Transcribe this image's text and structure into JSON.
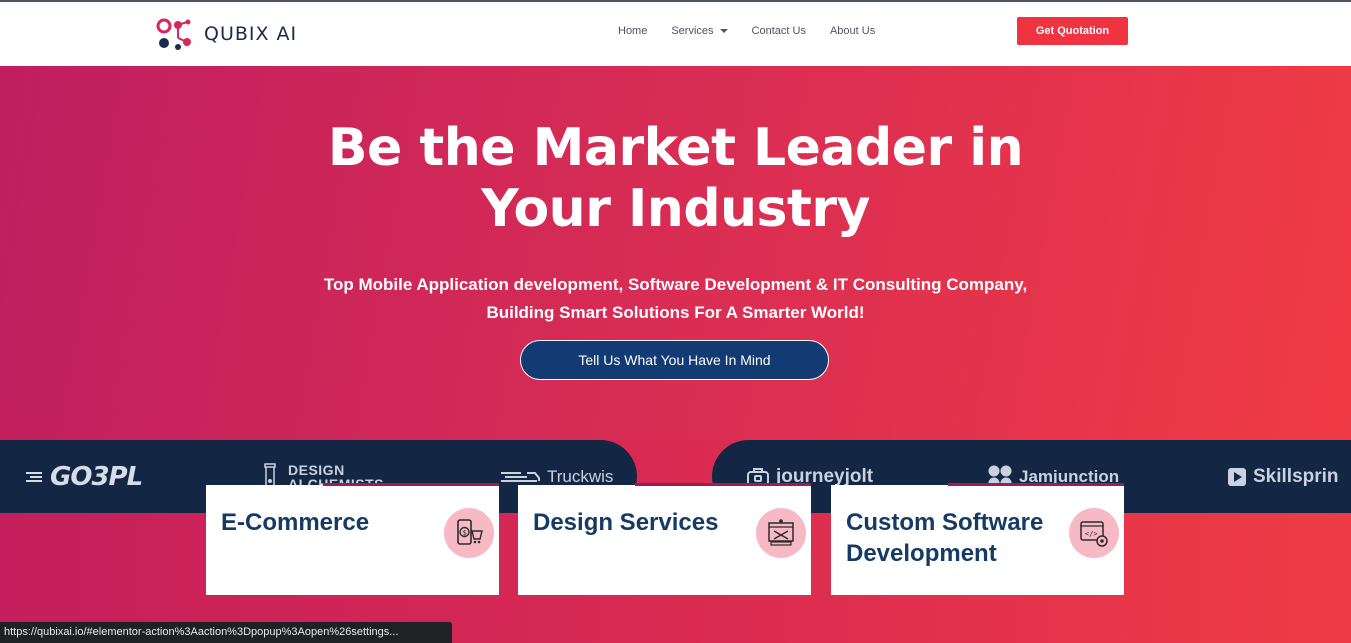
{
  "header": {
    "logo_text": "QUBIX AI",
    "nav": [
      {
        "label": "Home"
      },
      {
        "label": "Services"
      },
      {
        "label": "Contact Us"
      },
      {
        "label": "About Us"
      }
    ],
    "cta_label": "Get Quotation"
  },
  "hero": {
    "title_line1": "Be the Market Leader in",
    "title_line2": "Your Industry",
    "subtitle_line1": "Top Mobile Application development, Software Development & IT Consulting Company,",
    "subtitle_line2": "Building Smart Solutions For A Smarter World!",
    "button_label": "Tell Us What You Have In Mind"
  },
  "brands": {
    "go3pl": "GO3PL",
    "design_line1": "DESIGN",
    "design_line2": "ALCHEMISTS",
    "truckwis": "Truckwis",
    "journeyjolt": "journeyjolt",
    "jamjunction": "Jamjunction",
    "skillsprint": "Skillsprin"
  },
  "services": [
    {
      "title": "E-Commerce",
      "icon": "ecommerce-icon"
    },
    {
      "title": "Design Services",
      "icon": "design-icon"
    },
    {
      "title": "Custom Software Development",
      "icon": "software-icon"
    }
  ],
  "statusbar": {
    "url": "https://qubixai.io/#elementor-action%3Aaction%3Dpopup%3Aopen%26settings..."
  },
  "colors": {
    "accent": "#ef3340",
    "navy": "#132744",
    "button_navy": "#123a73",
    "card_title": "#163a66"
  }
}
